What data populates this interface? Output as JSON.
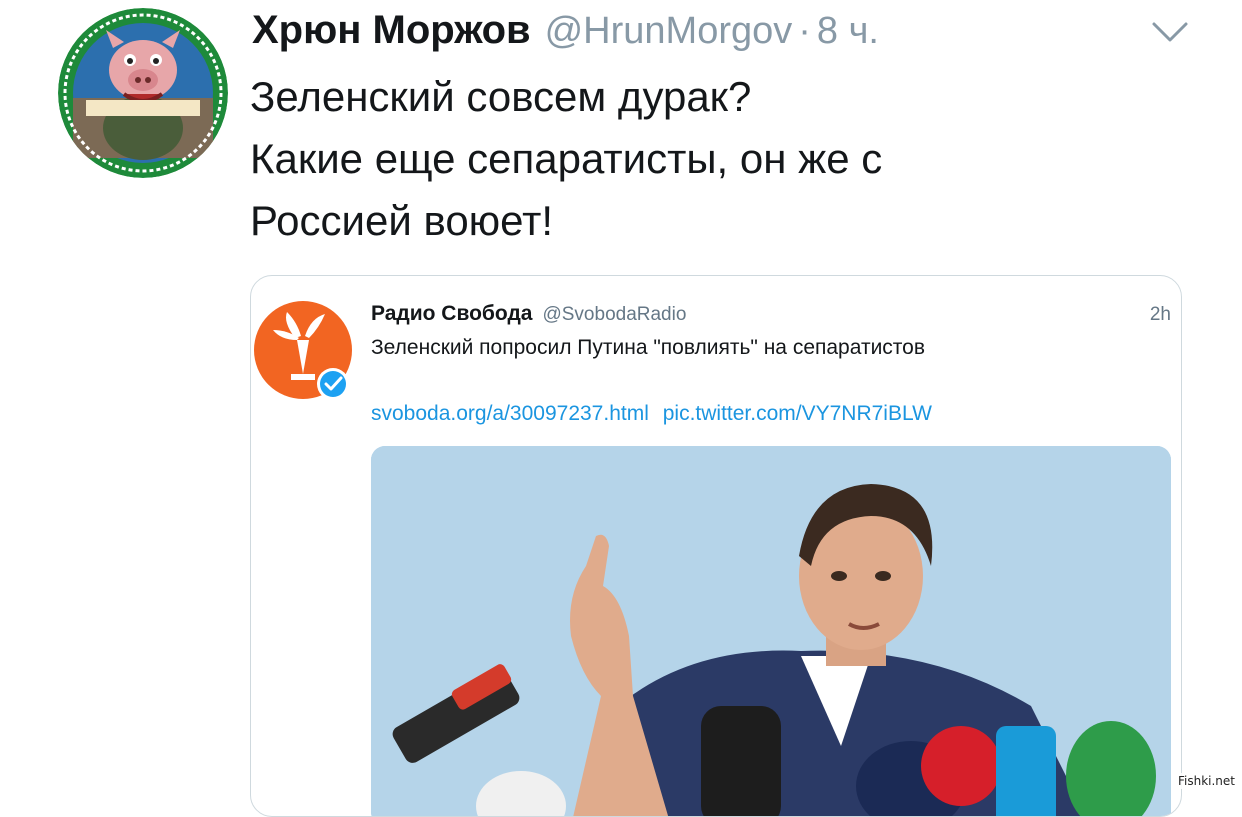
{
  "tweet": {
    "author_name": "Хрюн Моржов",
    "author_handle": "@HrunMorgov",
    "separator": "·",
    "timestamp": "8 ч.",
    "lines": [
      "Зеленский совсем дурак?",
      "Какие еще сепаратисты, он же с",
      "Россией воюет!"
    ],
    "avatar_icon": "pig-mascot-avatar",
    "menu_icon": "chevron-down-icon"
  },
  "quoted_tweet": {
    "author_name": "Радио Свобода",
    "author_handle": "@SvobodaRadio",
    "timestamp": "2h",
    "text": "Зеленский попросил Путина \"повлиять\" на сепаратистов",
    "link_article": "svoboda.org/a/30097237.html",
    "link_pic": "pic.twitter.com/VY7NR7iBLW",
    "verified": true,
    "brand_color": "#f26522",
    "link_color": "#1b95e0"
  },
  "watermark": "Fishki.net"
}
